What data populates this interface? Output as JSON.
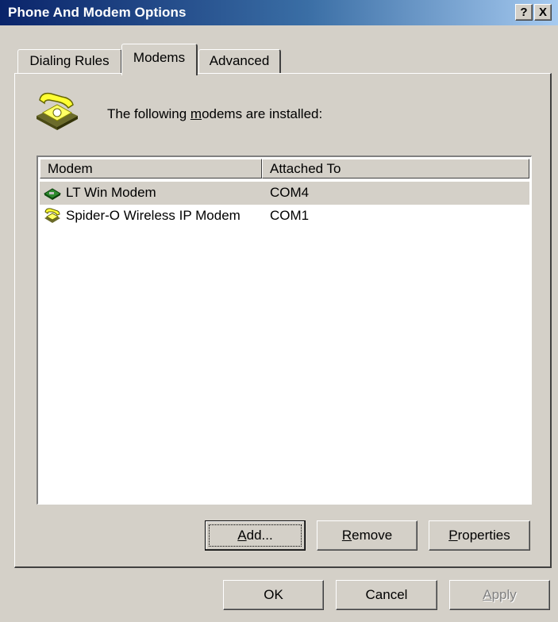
{
  "window": {
    "title": "Phone And Modem Options",
    "help_button": "?",
    "close_button": "X"
  },
  "tabs": [
    {
      "label": "Dialing Rules",
      "selected": false
    },
    {
      "label": "Modems",
      "selected": true
    },
    {
      "label": "Advanced",
      "selected": false
    }
  ],
  "intro": {
    "prefix": "The following ",
    "accel": "m",
    "suffix": "odems are  installed:"
  },
  "list": {
    "columns": [
      "Modem",
      "Attached To"
    ],
    "rows": [
      {
        "modem": "LT Win Modem",
        "attached_to": "COM4",
        "icon": "modem-card-icon",
        "selected": true
      },
      {
        "modem": "Spider-O Wireless IP Modem",
        "attached_to": "COM1",
        "icon": "phone-modem-icon",
        "selected": false
      }
    ]
  },
  "buttons": {
    "add": {
      "accel": "A",
      "rest": "dd..."
    },
    "remove": {
      "accel": "R",
      "rest": "emove"
    },
    "properties": {
      "accel": "P",
      "rest": "roperties"
    },
    "ok": "OK",
    "cancel": "Cancel",
    "apply": {
      "accel": "A",
      "rest": "pply",
      "enabled": false
    }
  },
  "colors": {
    "title_gradient_start": "#0a246a",
    "title_gradient_end": "#a6caf0",
    "face": "#d4d0c8"
  }
}
